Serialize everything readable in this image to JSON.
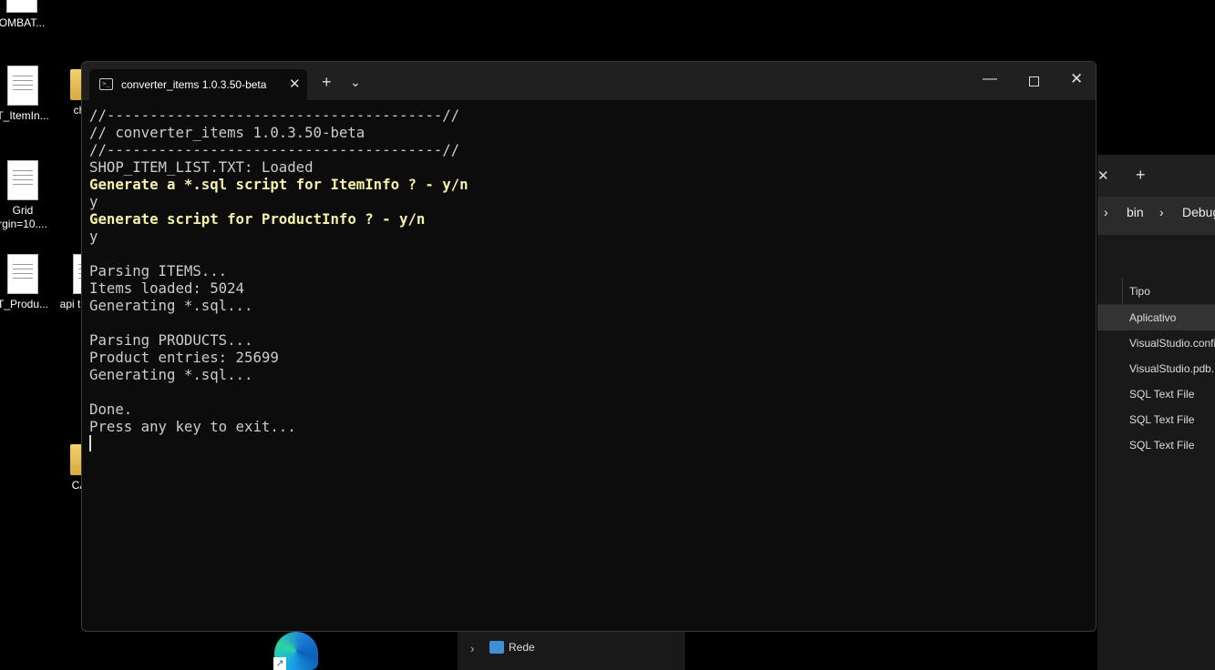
{
  "desktop": {
    "icons": [
      {
        "label": "OMBAT...",
        "icon": "text-file-icon"
      },
      {
        "label": "T_ItemIn...",
        "icon": "text-file-icon"
      },
      {
        "label": "ch",
        "icon": "folder-icon"
      },
      {
        "label": "Grid",
        "label2": "rgin=10....",
        "icon": "text-file-icon"
      },
      {
        "label": "T_Produ...",
        "icon": "text-file-icon"
      },
      {
        "label": "api t",
        "icon": "text-file-icon"
      },
      {
        "label": "CA",
        "icon": "folder-icon"
      }
    ]
  },
  "explorer": {
    "breadcrumbs": [
      "bin",
      "Debug"
    ],
    "column_header": "Tipo",
    "rows": [
      {
        "type": "Aplicativo",
        "selected": true
      },
      {
        "type": "VisualStudio.confi",
        "selected": false
      },
      {
        "type": "VisualStudio.pdb...",
        "selected": false
      },
      {
        "type": "SQL Text File",
        "selected": false
      },
      {
        "type": "SQL Text File",
        "selected": false
      },
      {
        "type": "SQL Text File",
        "selected": false
      }
    ],
    "nav_item": "Rede"
  },
  "terminal": {
    "tab_title": "converter_items 1.0.3.50-beta",
    "lines": [
      {
        "text": "//---------------------------------------//",
        "style": "normal"
      },
      {
        "text": "// converter_items 1.0.3.50-beta",
        "style": "normal"
      },
      {
        "text": "//---------------------------------------//",
        "style": "normal"
      },
      {
        "text": "SHOP_ITEM_LIST.TXT: Loaded",
        "style": "normal"
      },
      {
        "text": "Generate a *.sql script for ItemInfo ? - y/n",
        "style": "prompt"
      },
      {
        "text": "y",
        "style": "normal"
      },
      {
        "text": "Generate script for ProductInfo ? - y/n",
        "style": "prompt"
      },
      {
        "text": "y",
        "style": "normal"
      },
      {
        "text": "",
        "style": "normal"
      },
      {
        "text": "Parsing ITEMS...",
        "style": "normal"
      },
      {
        "text": "Items loaded: 5024",
        "style": "normal"
      },
      {
        "text": "Generating *.sql...",
        "style": "normal"
      },
      {
        "text": "",
        "style": "normal"
      },
      {
        "text": "Parsing PRODUCTS...",
        "style": "normal"
      },
      {
        "text": "Product entries: 25699",
        "style": "normal"
      },
      {
        "text": "Generating *.sql...",
        "style": "normal"
      },
      {
        "text": "",
        "style": "normal"
      },
      {
        "text": "Done.",
        "style": "normal"
      },
      {
        "text": "Press any key to exit...",
        "style": "normal"
      }
    ]
  },
  "colors": {
    "background": "#000000",
    "terminal_bg": "#0c0c0c",
    "titlebar_bg": "#202020",
    "console_text": "#cccccc",
    "prompt_text": "#f5f1a8"
  }
}
